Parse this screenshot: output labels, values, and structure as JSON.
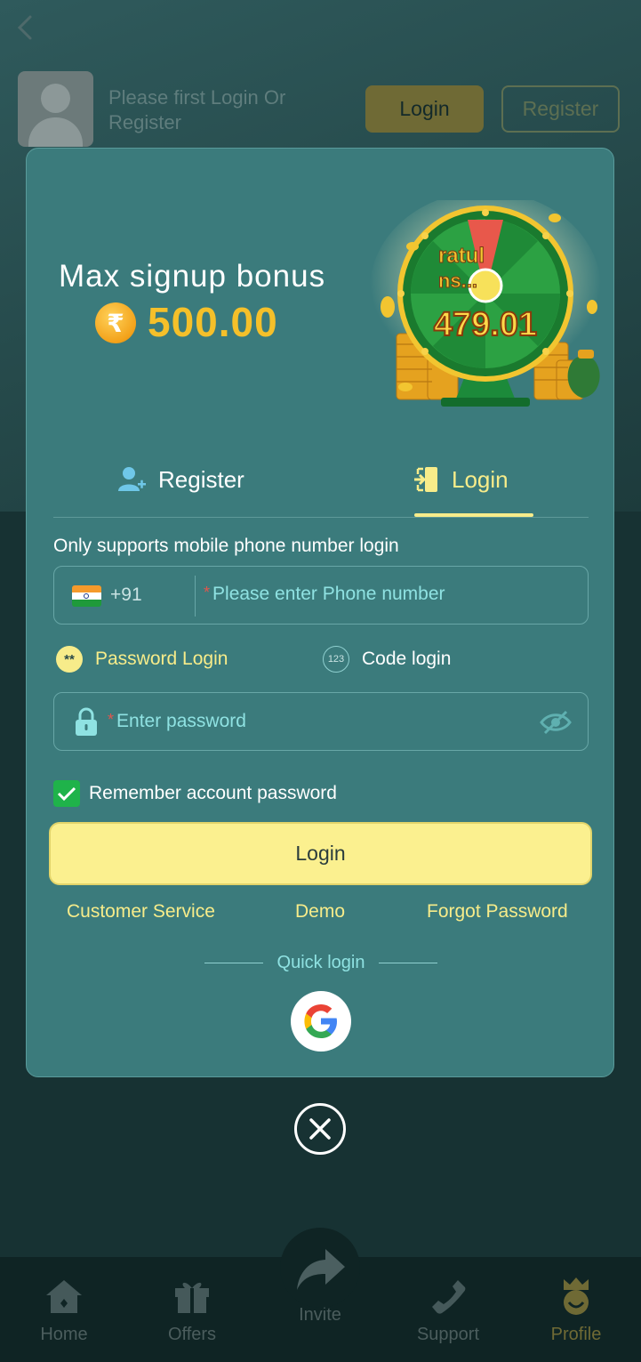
{
  "header": {
    "login_prompt": "Please first Login Or Register",
    "login_button": "Login",
    "register_button": "Register"
  },
  "modal": {
    "bonus_title": "Max signup bonus",
    "currency_symbol": "₹",
    "bonus_amount": "500.00",
    "wheel_banner_top": "ratul",
    "wheel_banner_bottom": "ns...",
    "wheel_amount": "479.01",
    "tabs": [
      {
        "label": "Register",
        "active": false
      },
      {
        "label": "Login",
        "active": true
      }
    ],
    "hint": "Only supports mobile phone number login",
    "phone": {
      "country_code": "+91",
      "required_mark": "*",
      "placeholder": "Please enter Phone number"
    },
    "login_modes": {
      "password_icon": "**",
      "password_label": "Password Login",
      "code_icon": "123",
      "code_label": "Code login"
    },
    "password": {
      "required_mark": "*",
      "placeholder": "Enter password"
    },
    "remember_label": "Remember account password",
    "remember_checked": true,
    "login_button": "Login",
    "links": {
      "customer_service": "Customer Service",
      "demo": "Demo",
      "forgot_password": "Forgot Password"
    },
    "quick_login": "Quick login"
  },
  "bottom_nav": [
    {
      "label": "Home",
      "icon": "home-icon"
    },
    {
      "label": "Offers",
      "icon": "gift-icon"
    },
    {
      "label": "Invite",
      "icon": "share-icon"
    },
    {
      "label": "Support",
      "icon": "phone-icon"
    },
    {
      "label": "Profile",
      "icon": "profile-icon",
      "active": true
    }
  ],
  "colors": {
    "modal_bg": "#3b7b7c",
    "accent_yellow": "#f7ec8a",
    "bonus_gold": "#f5c02a",
    "checkbox_green": "#1fb34a"
  }
}
